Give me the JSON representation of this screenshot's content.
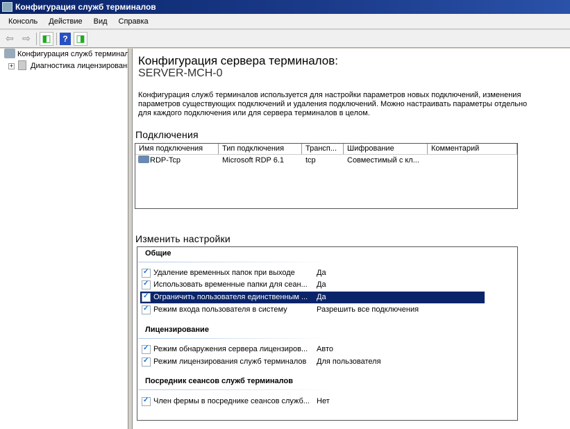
{
  "window": {
    "title": "Конфигурация служб терминалов"
  },
  "menu": [
    "Консоль",
    "Действие",
    "Вид",
    "Справка"
  ],
  "tree": [
    {
      "label": "Конфигурация служб терминалов"
    },
    {
      "label": "Диагностика лицензирования",
      "expander": "+"
    }
  ],
  "main": {
    "title": "Конфигурация сервера терминалов:",
    "server": "SERVER-MCH-0",
    "description": "Конфигурация служб терминалов используется для настройки параметров новых подключений, изменения параметров существующих подключений и удаления подключений. Можно настраивать параметры отдельно для каждого подключения или для сервера терминалов в целом.",
    "connections_title": "Подключения",
    "columns": [
      "Имя подключения",
      "Тип подключения",
      "Трансп...",
      "Шифрование",
      "Комментарий"
    ],
    "rows": [
      [
        "RDP-Tcp",
        "Microsoft RDP 6.1",
        "tcp",
        "Совместимый с кл...",
        ""
      ]
    ],
    "settings_title": "Изменить настройки",
    "groups": [
      {
        "name": "Общие",
        "items": [
          {
            "name": "Удаление временных папок при выходе",
            "value": "Да"
          },
          {
            "name": "Использовать временные папки для сеан...",
            "value": "Да"
          },
          {
            "name": "Ограничить пользователя единственным ...",
            "value": "Да",
            "selected": true
          },
          {
            "name": "Режим входа пользователя в систему",
            "value": "Разрешить все подключения"
          }
        ]
      },
      {
        "name": "Лицензирование",
        "items": [
          {
            "name": "Режим обнаружения сервера лицензиров...",
            "value": "Авто"
          },
          {
            "name": "Режим лицензирования служб терминалов",
            "value": "Для пользователя"
          }
        ]
      },
      {
        "name": "Посредник сеансов служб терминалов",
        "items": [
          {
            "name": "Член фермы в посреднике сеансов служб...",
            "value": "Нет"
          }
        ]
      }
    ]
  }
}
